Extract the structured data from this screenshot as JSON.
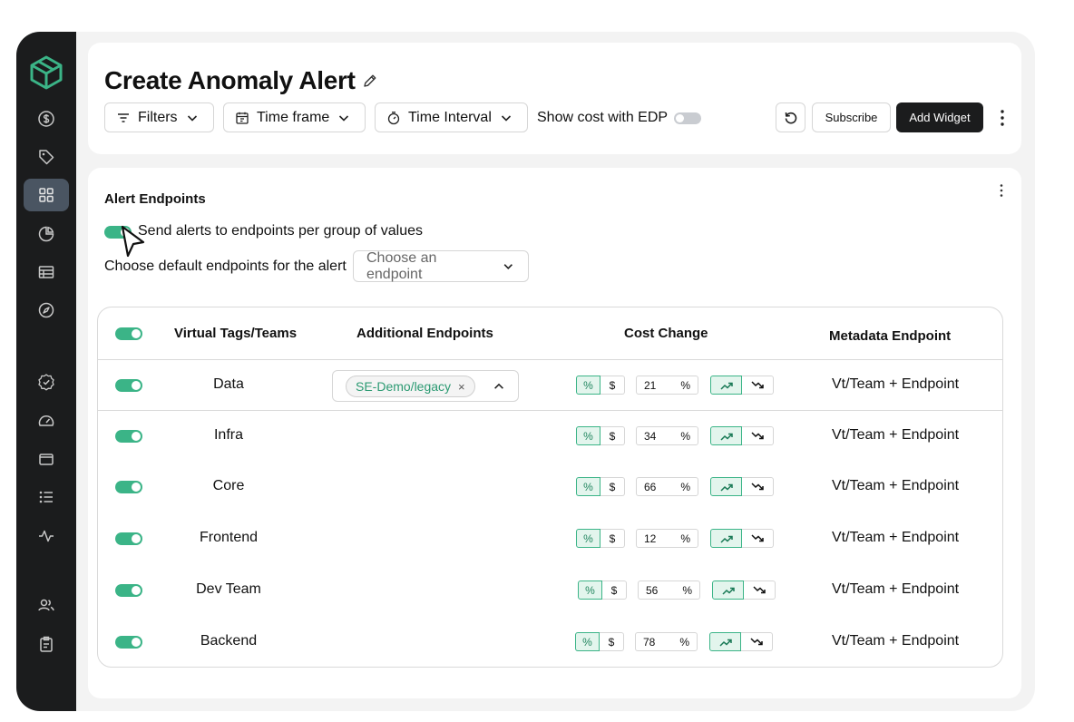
{
  "header": {
    "title": "Create Anomaly Alert",
    "filters_label": "Filters",
    "timeframe_label": "Time frame",
    "interval_label": "Time Interval",
    "edp_label": "Show cost with EDP",
    "subscribe_label": "Subscribe",
    "add_widget_label": "Add Widget"
  },
  "section": {
    "title": "Alert Endpoints",
    "send_label": "Send alerts to endpoints per group of values",
    "choose_label": "Choose default endpoints for the alert",
    "select_placeholder": "Choose an endpoint"
  },
  "table": {
    "headers": {
      "tags": "Virtual Tags/Teams",
      "endpoints": "Additional Endpoints",
      "cost": "Cost Change",
      "meta": "Metadata Endpoint"
    },
    "pct_symbol": "%",
    "usd_symbol": "$",
    "rows": [
      {
        "name": "Data",
        "value": "21",
        "unit": "%",
        "meta": "Vt/Team + Endpoint",
        "chip": "SE-Demo/legacy",
        "chip_x": "×"
      },
      {
        "name": "Infra",
        "value": "34",
        "unit": "%",
        "meta": "Vt/Team + Endpoint"
      },
      {
        "name": "Core",
        "value": "66",
        "unit": "%",
        "meta": "Vt/Team + Endpoint"
      },
      {
        "name": "Frontend",
        "value": "12",
        "unit": "%",
        "meta": "Vt/Team + Endpoint"
      },
      {
        "name": "Dev Team",
        "value": "56",
        "unit": "%",
        "meta": "Vt/Team + Endpoint"
      },
      {
        "name": "Backend",
        "value": "78",
        "unit": "%",
        "meta": "Vt/Team + Endpoint"
      }
    ]
  },
  "colors": {
    "accent": "#3bb487",
    "sidebar": "#1b1c1d",
    "active_nav": "#4a5562"
  },
  "icons": {
    "sidebar": [
      "logo-cube-icon",
      "dollar-icon",
      "tag-icon",
      "dashboard-grid-icon",
      "pie-chart-icon",
      "table-icon",
      "compass-icon",
      "badge-check-icon",
      "gauge-icon",
      "wallet-icon",
      "list-icon",
      "activity-icon",
      "users-icon",
      "clipboard-icon"
    ]
  }
}
